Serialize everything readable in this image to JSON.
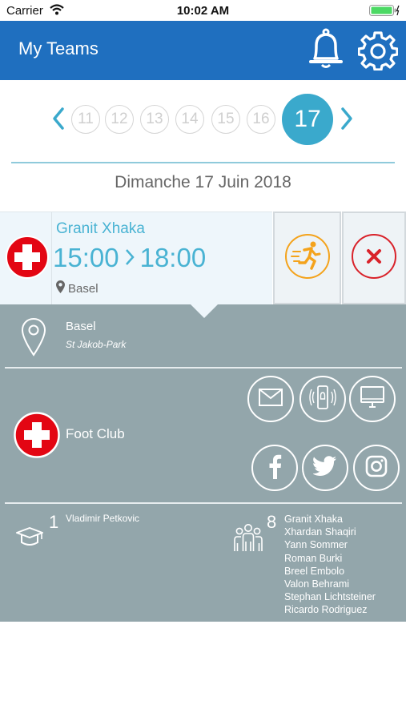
{
  "status_bar": {
    "carrier": "Carrier",
    "time": "10:02 AM"
  },
  "nav": {
    "title": "My Teams",
    "bell_icon": "bell-icon",
    "settings_icon": "gear-icon"
  },
  "week": {
    "days": [
      "11",
      "12",
      "13",
      "14",
      "15",
      "16",
      "17"
    ],
    "selected": "17",
    "accent_color": "#3aa9cc"
  },
  "date_label": "Dimanche 17 Juin 2018",
  "event": {
    "player": "Granit Xhaka",
    "start": "15:00",
    "end": "18:00",
    "location": "Basel",
    "run_color": "#f4a31c",
    "cancel_color": "#d9222a"
  },
  "detail": {
    "venue_city": "Basel",
    "venue_stadium": "St Jakob-Park",
    "club_name": "Foot Club",
    "coach_count": "1",
    "coach_name": "Vladimir Petkovic",
    "player_count": "8",
    "players": [
      "Granit Xhaka",
      "Xhardan Shaqiri",
      "Yann Sommer",
      "Roman Burki",
      "Breel Embolo",
      "Valon Behrami",
      "Stephan Lichtsteiner",
      "Ricardo Rodriguez"
    ]
  },
  "colors": {
    "nav_bar": "#1f6fbf",
    "panel": "#93a6ab"
  }
}
